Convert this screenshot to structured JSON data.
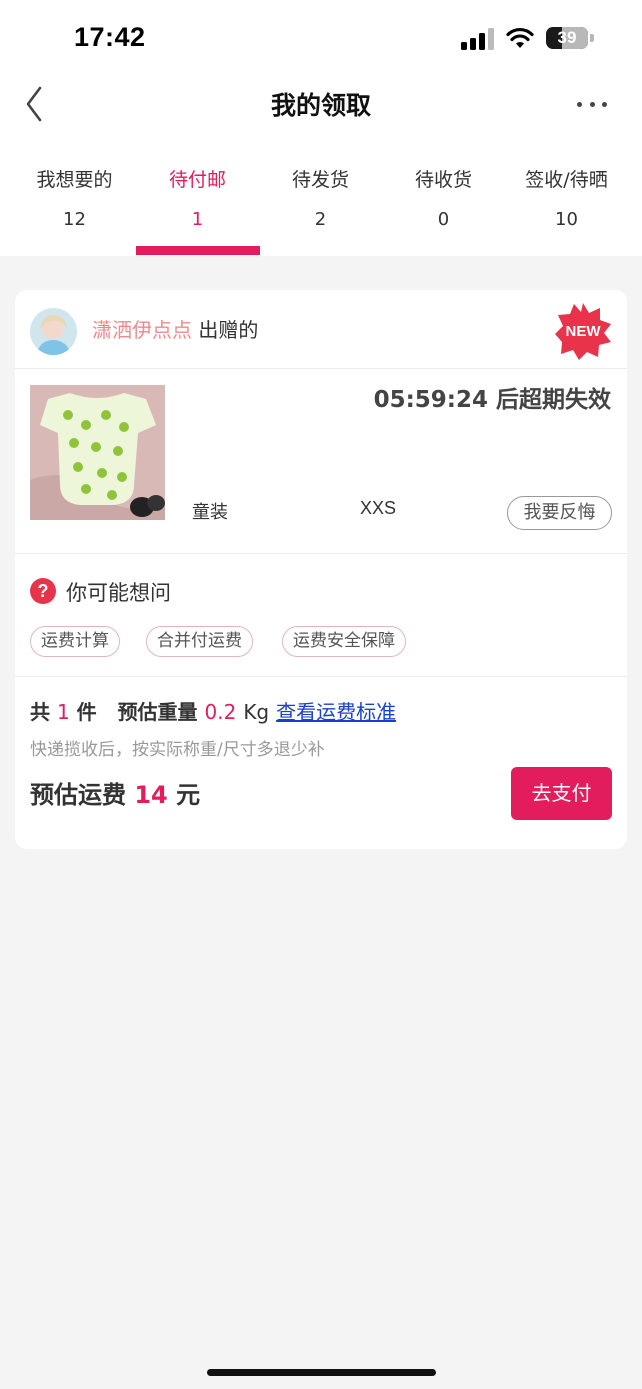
{
  "status_bar": {
    "time": "17:42",
    "battery_level": "39"
  },
  "header": {
    "title": "我的领取",
    "back_icon": "chevron-left-icon",
    "more_icon": "more-dots-icon"
  },
  "tabs": [
    {
      "label": "我想要的",
      "count": "12"
    },
    {
      "label": "待付邮",
      "count": "1"
    },
    {
      "label": "待发货",
      "count": "2"
    },
    {
      "label": "待收货",
      "count": "0"
    },
    {
      "label": "签收/待晒",
      "count": "10"
    }
  ],
  "active_tab": 1,
  "order": {
    "donor_name": "潇洒伊点点",
    "donor_suffix": "出赠的",
    "badge": "NEW",
    "countdown": "05:59:24 后超期失效",
    "category": "童装",
    "size": "XXS",
    "regret_label": "我要反悔",
    "faq_title": "你可能想问",
    "faq_tags": [
      "运费计算",
      "合并付运费",
      "运费安全保障"
    ],
    "summary": {
      "total_prefix": "共",
      "total_count": "1",
      "total_suffix": "件",
      "weight_label": "预估重量",
      "weight_value": "0.2",
      "weight_unit": "Kg",
      "link": "查看运费标准"
    },
    "note": "快递揽收后，按实际称重/尺寸多退少补",
    "fee_label": "预估运费",
    "fee_amount": "14",
    "fee_unit": "元",
    "pay_label": "去支付"
  },
  "colors": {
    "accent": "#e31c5d",
    "donor_name": "#f08a8a",
    "link": "#1b3fd0",
    "background": "#f4f4f4"
  }
}
